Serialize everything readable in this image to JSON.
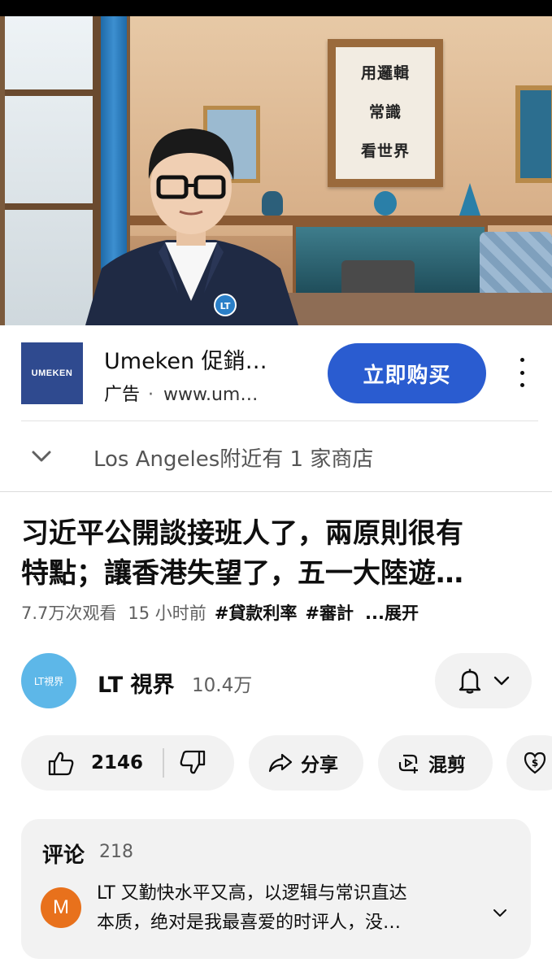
{
  "video": {
    "sign_lines": [
      "用邏輯",
      "常識",
      "看世界"
    ],
    "progress_fraction": 0.0,
    "badge_text": "LT"
  },
  "ad": {
    "logo_text": "UMEKEN",
    "title": "Umeken 促銷…",
    "label": "广告",
    "separator": "·",
    "url": "www.um…",
    "cta_label": "立即购买"
  },
  "store": {
    "text": "Los Angeles附近有 1 家商店"
  },
  "title": {
    "line1": "习近平公開談接班人了，兩原則很有",
    "line2": "特點；讓香港失望了，五一大陸遊…"
  },
  "meta": {
    "views": "7.7万次观看",
    "age": "15 小时前",
    "tag1": "#貸款利率",
    "tag2": "#審計",
    "more": "...展开"
  },
  "channel": {
    "avatar_text": "LT視界",
    "name": "LT 視界",
    "subscribers": "10.4万"
  },
  "actions": {
    "like_count": "2146",
    "share_label": "分享",
    "remix_label": "混剪"
  },
  "comments": {
    "heading": "评论",
    "count": "218",
    "avatar_letter": "M",
    "line1": "LT 又勤快水平又高，以逻辑与常识直达",
    "line2": "本质，绝对是我最喜爱的时评人，没…"
  },
  "colors": {
    "cta_blue": "#2a5cd0",
    "pill_gray": "#f2f2f2",
    "channel_avatar": "#5db7e8",
    "comment_avatar": "#e8711c",
    "ad_logo_bg": "#2f4a8f"
  },
  "icons": [
    "kebab-menu-icon",
    "chevron-down-icon",
    "bell-icon",
    "thumbs-up-icon",
    "thumbs-down-icon",
    "share-arrow-icon",
    "remix-icon",
    "thanks-dollar-icon"
  ]
}
